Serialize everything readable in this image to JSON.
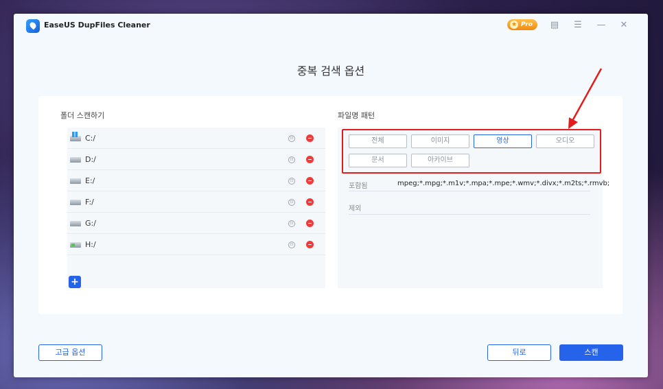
{
  "app": {
    "title": "EaseUS DupFiles Cleaner",
    "pro_label": "Pro"
  },
  "page": {
    "title": "중복 검색 옵션"
  },
  "folders": {
    "section_title": "폴더 스캔하기",
    "items": [
      {
        "label": "C:/",
        "type": "system"
      },
      {
        "label": "D:/",
        "type": "disk"
      },
      {
        "label": "E:/",
        "type": "disk"
      },
      {
        "label": "F:/",
        "type": "disk"
      },
      {
        "label": "G:/",
        "type": "disk"
      },
      {
        "label": "H:/",
        "type": "usb"
      }
    ]
  },
  "patterns": {
    "section_title": "파일명 패턴",
    "types": [
      {
        "label": "전체",
        "active": false
      },
      {
        "label": "이미지",
        "active": false
      },
      {
        "label": "영상",
        "active": true
      },
      {
        "label": "오디오",
        "active": false
      },
      {
        "label": "문서",
        "active": false
      },
      {
        "label": "아카이브",
        "active": false
      }
    ],
    "include_label": "포함됨",
    "include_value": "mpeg;*.mpg;*.m1v;*.mpa;*.mpe;*.wmv;*.divx;*.m2ts;*.rmvb;",
    "exclude_label": "제외"
  },
  "footer": {
    "advanced_label": "고급 옵션",
    "back_label": "뒤로",
    "scan_label": "스캔"
  },
  "colors": {
    "accent": "#2563eb",
    "highlight": "#e21c1c",
    "remove": "#ee3b3b"
  }
}
